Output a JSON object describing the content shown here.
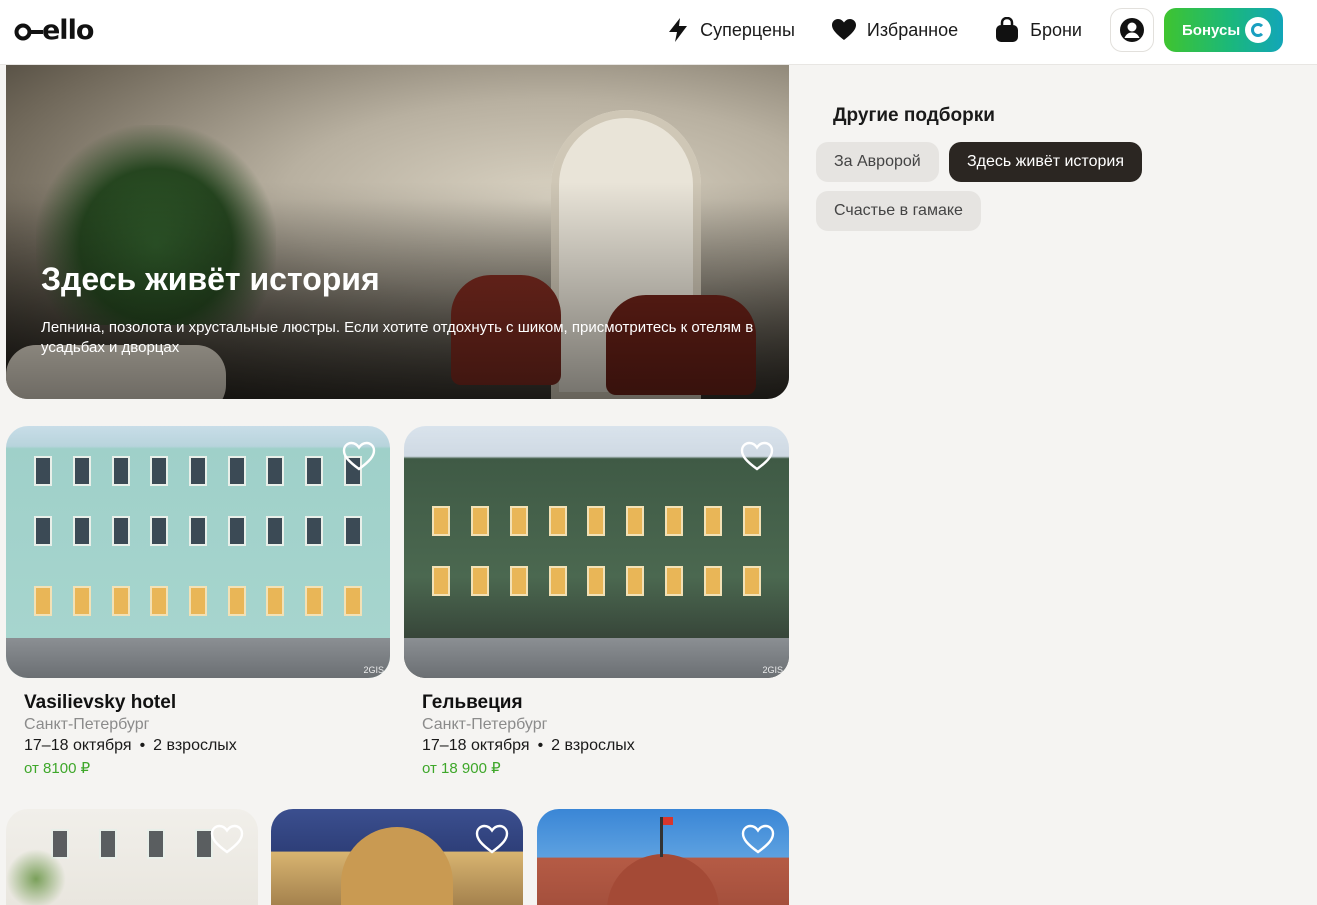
{
  "header": {
    "logo": "otello",
    "nav": [
      {
        "label": "Суперцены",
        "icon": "lightning-icon"
      },
      {
        "label": "Избранное",
        "icon": "heart-icon"
      },
      {
        "label": "Брони",
        "icon": "bag-icon"
      }
    ],
    "profile_icon": "user-icon",
    "bonus_label": "Бонусы",
    "bonus_icon": "bonus-coin-icon"
  },
  "hero": {
    "title": "Здесь живёт история",
    "description": "Лепнина, позолота и хрустальные люстры. Если хотите отдохнуть с шиком, присмотритесь к отелям в усадьбах и дворцах"
  },
  "sidebar": {
    "title": "Другие подборки",
    "chips": [
      {
        "label": "За Авророй",
        "active": false
      },
      {
        "label": "Здесь живёт история",
        "active": true
      },
      {
        "label": "Счастье в гамаке",
        "active": false
      }
    ]
  },
  "hotels": [
    {
      "name": "Vasilievsky hotel",
      "city": "Санкт-Петербург",
      "dates": "17–18 октября",
      "guests": "2 взрослых",
      "price": "от 8100 ₽",
      "image_credit": "2GIS"
    },
    {
      "name": "Гельвеция",
      "city": "Санкт-Петербург",
      "dates": "17–18 октября",
      "guests": "2 взрослых",
      "price": "от 18 900 ₽",
      "image_credit": "2GIS"
    }
  ],
  "colors": {
    "accent_green": "#3ea72a",
    "chip_active": "#2b2622",
    "chip_inactive": "#e6e4e1"
  }
}
